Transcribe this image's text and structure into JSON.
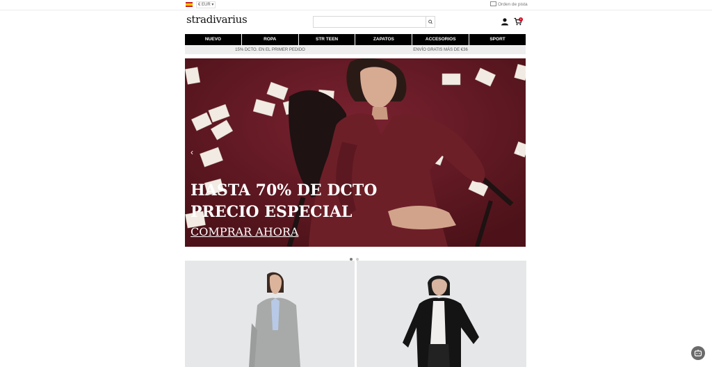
{
  "topbar": {
    "currency": "€ EUR ▾",
    "order_tracking": "Orden de pista"
  },
  "header": {
    "logo": "stradivarius",
    "search": {
      "placeholder": "",
      "value": ""
    },
    "cart_count": "0"
  },
  "nav": {
    "items": [
      "NUEVO",
      "ROPA",
      "STR TEEN",
      "ZAPATOS",
      "ACCESORIOS",
      "SPORT"
    ]
  },
  "promo": {
    "left": "15% DCTO. EN EL PRIMER PEDIDO",
    "right": "ENVÍO GRATIS MÁS DE €36"
  },
  "hero": {
    "line1": "HASTA 70% DE DCTO",
    "line2": "PRECIO ESPECIAL",
    "cta": "COMPRAR AHORA",
    "prev_arrow": "‹",
    "next_arrow": "›",
    "active_slide": 1,
    "slide_count": 2,
    "colors": {
      "background": "#611a22",
      "dress": "#6d1f28"
    }
  },
  "icons": [
    "flag-spain-icon",
    "envelope-icon",
    "search-icon",
    "user-icon",
    "cart-icon",
    "chevron-left-icon",
    "chevron-right-icon",
    "chat-icon"
  ],
  "colors": {
    "nav_bg": "#000000",
    "promo_bg": "#eeeeee",
    "badge": "#d0021b",
    "card_bg": "#e6e7e9"
  }
}
